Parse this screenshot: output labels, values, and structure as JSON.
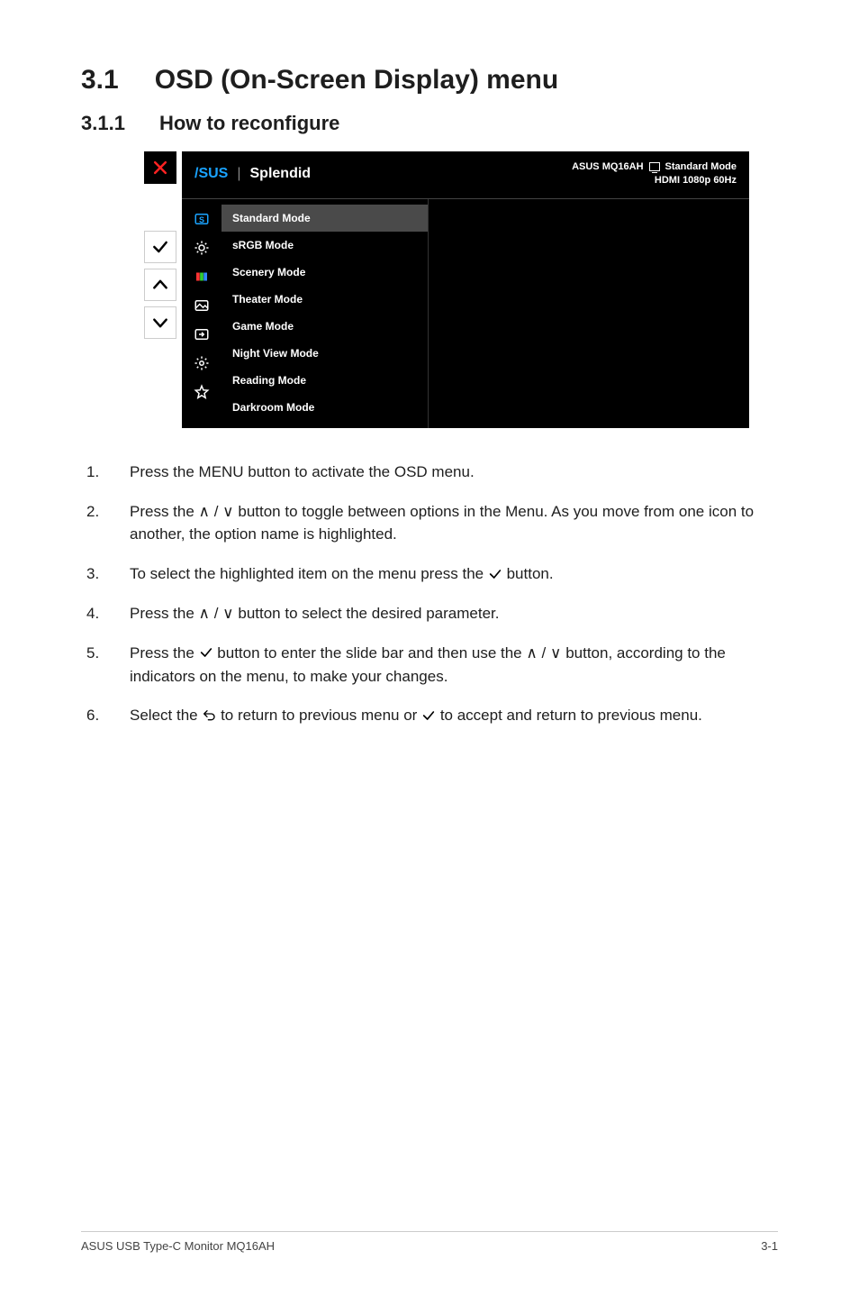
{
  "headings": {
    "h1_num": "3.1",
    "h1_title": "OSD (On-Screen Display) menu",
    "h2_num": "3.1.1",
    "h2_title": "How to reconfigure"
  },
  "osd": {
    "brand": "/SUS",
    "title": "Splendid",
    "status": {
      "model": "ASUS MQ16AH",
      "mode_label": "Standard Mode",
      "signal": "HDMI  1080p 60Hz"
    },
    "icons": [
      {
        "name": "s-icon"
      },
      {
        "name": "brightness-icon"
      },
      {
        "name": "color-icon"
      },
      {
        "name": "image-icon"
      },
      {
        "name": "input-icon"
      },
      {
        "name": "settings-icon"
      },
      {
        "name": "star-icon"
      }
    ],
    "modes": [
      "Standard Mode",
      "sRGB Mode",
      "Scenery Mode",
      "Theater Mode",
      "Game Mode",
      "Night View Mode",
      "Reading Mode",
      "Darkroom Mode"
    ]
  },
  "steps": {
    "s1": "Press the MENU button to activate the OSD menu.",
    "s2a": "Press the ",
    "s2b": " button to toggle between options in the Menu. As you move from one icon to another, the option name is highlighted.",
    "s3a": "To select the highlighted item on the menu press the ",
    "s3b": " button.",
    "s4a": "Press the ",
    "s4b": " button to select the desired parameter.",
    "s5a": "Press the ",
    "s5b": " button to enter the slide bar and then use the ",
    "s5c": " button, according to the indicators on the menu, to make your changes.",
    "s6a": "Select the ",
    "s6b": " to return to previous menu or ",
    "s6c": " to accept and return to previous menu."
  },
  "glyphs": {
    "up": "∧",
    "down": "∨",
    "sep": " / "
  },
  "footer": {
    "left": "ASUS USB Type-C Monitor MQ16AH",
    "right": "3-1"
  }
}
